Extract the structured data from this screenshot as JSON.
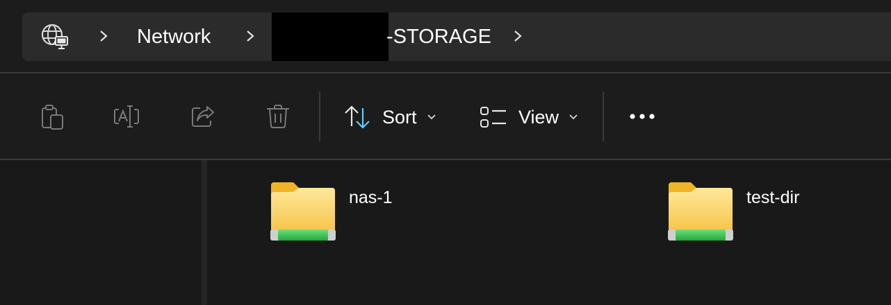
{
  "breadcrumb": {
    "items": [
      {
        "icon": "network-globe-icon"
      },
      {
        "label": "Network"
      },
      {
        "label": "-STORAGE"
      }
    ]
  },
  "toolbar": {
    "copy_icon": "clipboard-copy-icon",
    "rename_icon": "rename-icon",
    "share_icon": "share-icon",
    "delete_icon": "trash-icon",
    "sort_label": "Sort",
    "view_label": "View",
    "more_icon": "more-ellipsis-icon"
  },
  "files": [
    {
      "name": "nas-1",
      "icon": "network-share-folder-icon"
    },
    {
      "name": "test-dir",
      "icon": "network-share-folder-icon"
    }
  ],
  "colors": {
    "background": "#1c1c1c",
    "address_bar": "#2b2b2b",
    "accent_blue": "#60cdff",
    "folder_yellow": "#ffd75e",
    "share_green": "#3ec45a"
  }
}
